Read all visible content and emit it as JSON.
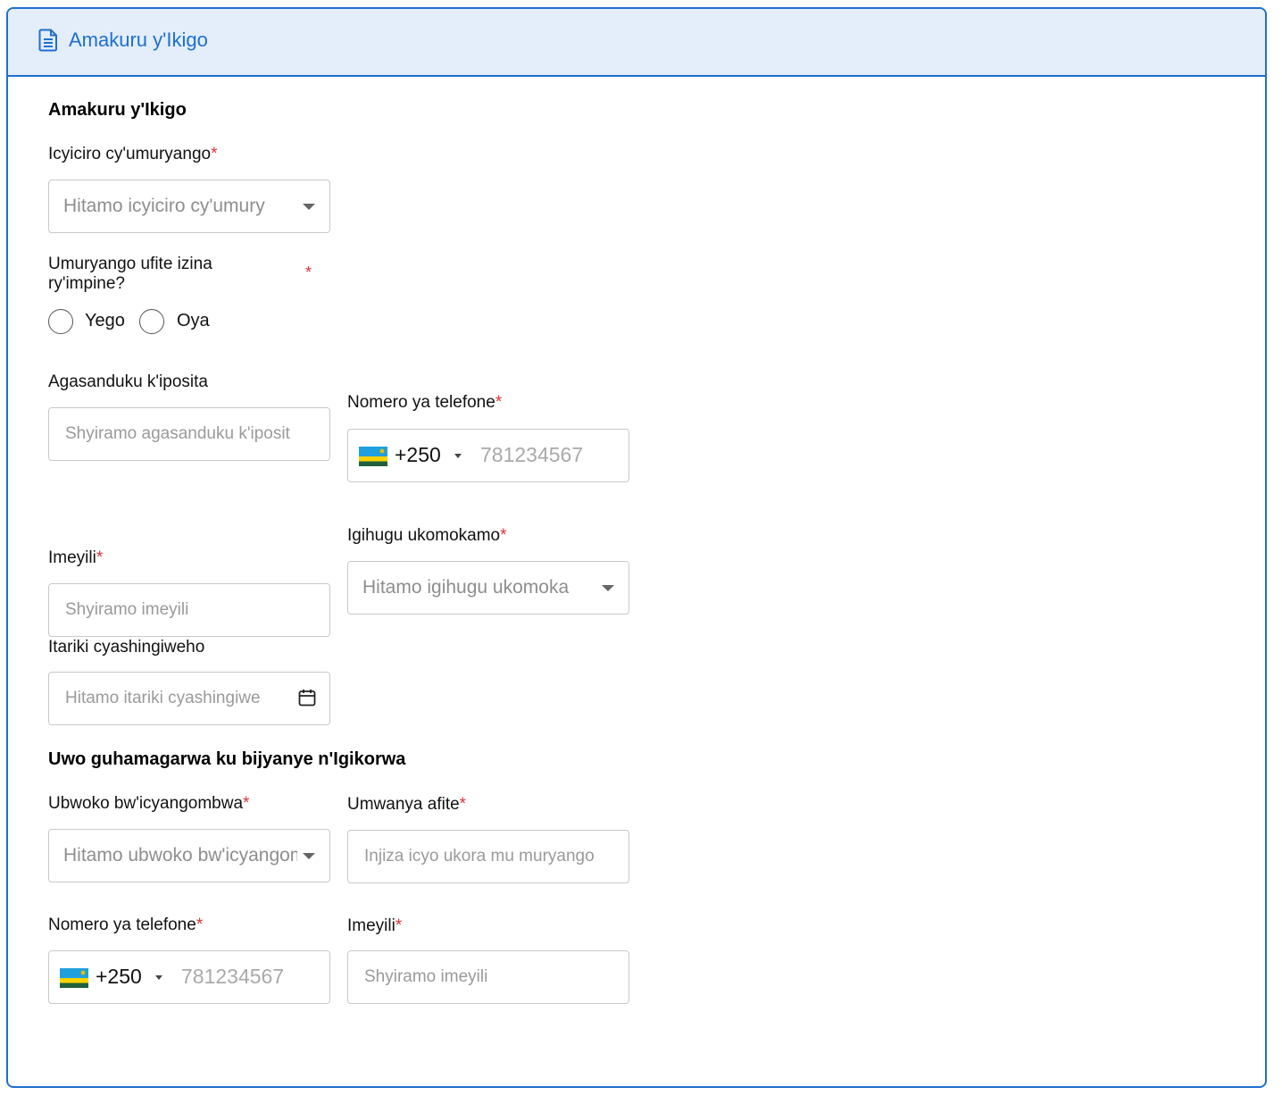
{
  "header": {
    "title": "Amakuru y'Ikigo",
    "icon": "document-icon"
  },
  "section1": {
    "title": "Amakuru y'Ikigo",
    "category": {
      "label": "Icyiciro cy'umuryango",
      "required": "*",
      "placeholder": "Hitamo icyiciro cy'umury"
    },
    "other_name": {
      "label_line1": "Umuryango ufite izina",
      "label_line2": "ry'impine?",
      "required": "*",
      "options": [
        "Yego",
        "Oya"
      ]
    },
    "po_box": {
      "label": "Agasanduku k'iposita",
      "placeholder": "Shyiramo agasanduku k'iposit"
    },
    "phone": {
      "label": "Nomero ya telefone",
      "required": "*",
      "code": "+250",
      "placeholder": "781234567"
    },
    "email": {
      "label": "Imeyili",
      "required": "*",
      "placeholder": "Shyiramo imeyili"
    },
    "country": {
      "label": "Igihugu ukomokamo",
      "required": "*",
      "placeholder": "Hitamo igihugu ukomoka"
    },
    "date": {
      "label": "Itariki cyashingiweho",
      "placeholder": "Hitamo itariki cyashingiwe"
    }
  },
  "section2": {
    "title": "Uwo guhamagarwa ku bijyanye n'Igikorwa",
    "id_type": {
      "label": "Ubwoko bw'icyangombwa",
      "required": "*",
      "placeholder": "Hitamo ubwoko bw'icyangombwa"
    },
    "position": {
      "label": "Umwanya afite",
      "required": "*",
      "placeholder": "Injiza icyo ukora mu muryango"
    },
    "phone": {
      "label": "Nomero ya telefone",
      "required": "*",
      "code": "+250",
      "placeholder": "781234567"
    },
    "email": {
      "label": "Imeyili",
      "required": "*",
      "placeholder": "Shyiramo imeyili"
    }
  },
  "colors": {
    "accent": "#1f6fd1",
    "header_bg": "#e3eefa",
    "required": "#e0323c"
  }
}
